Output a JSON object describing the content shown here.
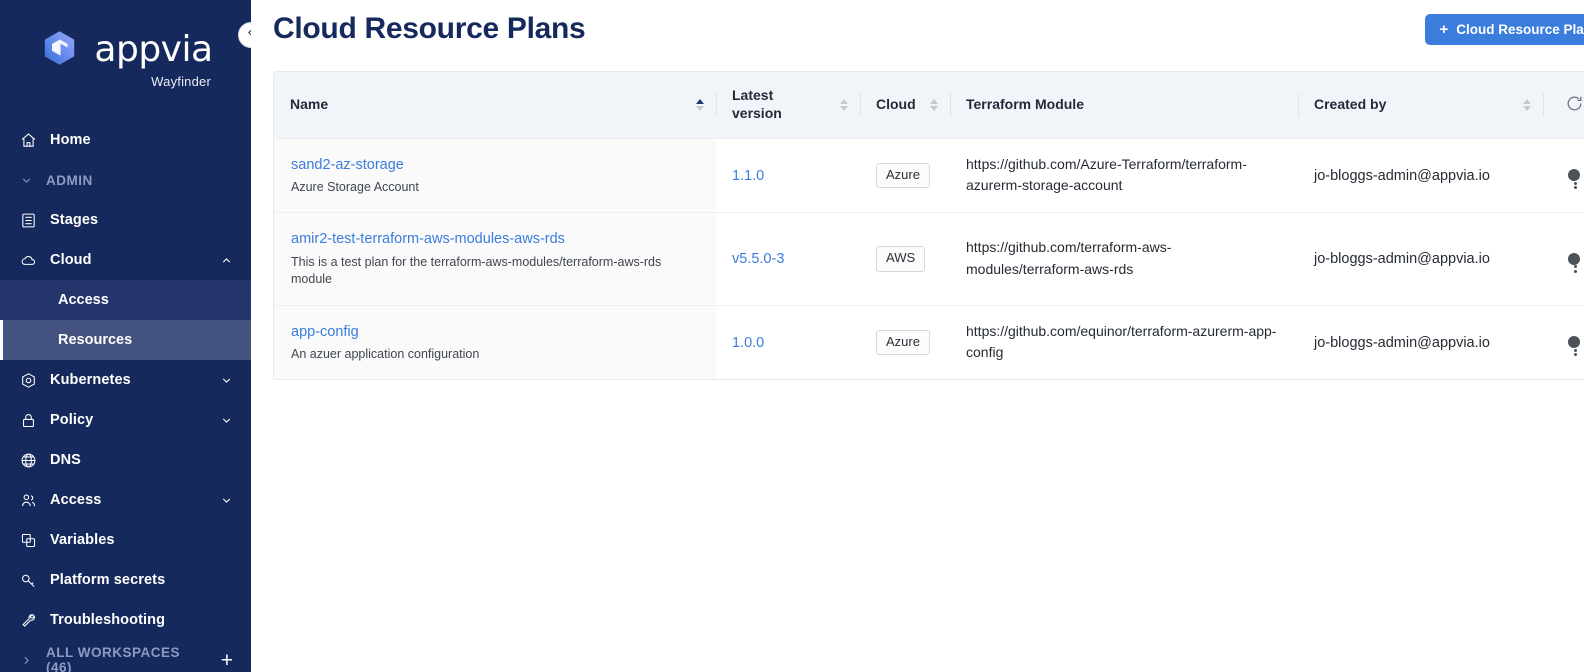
{
  "brand": {
    "name": "appvia",
    "product": "Wayfinder",
    "logo_icon": "appvia-hexagon-logo"
  },
  "sidebar": {
    "collapse_toggle_icon": "double-chevron-left-icon",
    "items": [
      {
        "label": "Home",
        "icon": "home-icon",
        "type": "item"
      },
      {
        "label": "ADMIN",
        "icon": "chevron-down-icon",
        "type": "section"
      },
      {
        "label": "Stages",
        "icon": "stages-icon",
        "type": "item"
      },
      {
        "label": "Cloud",
        "icon": "cloud-icon",
        "type": "item",
        "expanded": true,
        "caret": "chevron-up-icon"
      },
      {
        "label": "Access",
        "type": "sub",
        "state": "hovered"
      },
      {
        "label": "Resources",
        "type": "sub",
        "state": "active"
      },
      {
        "label": "Kubernetes",
        "icon": "kubernetes-icon",
        "type": "item",
        "caret": "chevron-down-icon"
      },
      {
        "label": "Policy",
        "icon": "lock-icon",
        "type": "item",
        "caret": "chevron-down-icon"
      },
      {
        "label": "DNS",
        "icon": "globe-icon",
        "type": "item"
      },
      {
        "label": "Access",
        "icon": "users-icon",
        "type": "item",
        "caret": "chevron-down-icon"
      },
      {
        "label": "Variables",
        "icon": "variables-icon",
        "type": "item"
      },
      {
        "label": "Platform secrets",
        "icon": "key-icon",
        "type": "item"
      },
      {
        "label": "Troubleshooting",
        "icon": "wrench-icon",
        "type": "item"
      }
    ],
    "workspaces": {
      "label": "ALL WORKSPACES (46)",
      "caret_icon": "chevron-right-icon",
      "add_icon": "plus-icon"
    }
  },
  "header": {
    "title": "Cloud Resource Plans",
    "primary_button": {
      "label": "Cloud Resource Plan",
      "icon": "plus-icon"
    }
  },
  "table": {
    "refresh_icon": "refresh-icon",
    "row_menu_icon": "kebab-menu-icon",
    "columns": [
      {
        "key": "name",
        "label": "Name",
        "sortable": true,
        "sort": "asc"
      },
      {
        "key": "version",
        "label": "Latest version",
        "sortable": true,
        "sort": "none"
      },
      {
        "key": "cloud",
        "label": "Cloud",
        "sortable": true,
        "sort": "none"
      },
      {
        "key": "module",
        "label": "Terraform Module",
        "sortable": false
      },
      {
        "key": "created_by",
        "label": "Created by",
        "sortable": true,
        "sort": "none"
      }
    ],
    "rows": [
      {
        "name": "sand2-az-storage",
        "description": "Azure Storage Account",
        "version": "1.1.0",
        "cloud": "Azure",
        "module": "https://github.com/Azure-Terraform/terraform-azurerm-storage-account",
        "created_by": "jo-bloggs-admin@appvia.io"
      },
      {
        "name": "amir2-test-terraform-aws-modules-aws-rds",
        "description": "This is a test plan for the terraform-aws-modules/terraform-aws-rds module",
        "version": "v5.5.0-3",
        "cloud": "AWS",
        "module": "https://github.com/terraform-aws-modules/terraform-aws-rds",
        "created_by": "jo-bloggs-admin@appvia.io"
      },
      {
        "name": "app-config",
        "description": "An azuer application configuration",
        "version": "1.0.0",
        "cloud": "Azure",
        "module": "https://github.com/equinor/terraform-azurerm-app-config",
        "created_by": "jo-bloggs-admin@appvia.io"
      }
    ]
  },
  "colors": {
    "sidebar_bg": "#16295c",
    "sidebar_active": "#43527e",
    "sidebar_hover": "#23356a",
    "accent_blue": "#3b7ddd",
    "title_navy": "#16295c",
    "table_header_bg": "#f1f5f9",
    "name_cell_bg": "#fafafa"
  }
}
